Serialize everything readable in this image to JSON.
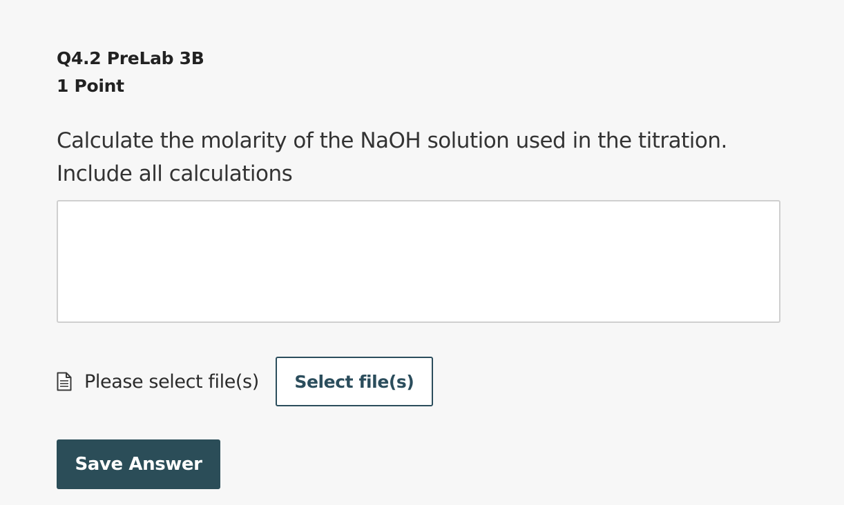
{
  "question": {
    "title": "Q4.2 PreLab 3B",
    "points": "1 Point",
    "prompt_line_1": "Calculate the molarity of the NaOH solution used in the titration.",
    "prompt_line_2": "Include all calculations"
  },
  "answer": {
    "value": "",
    "placeholder": ""
  },
  "file_upload": {
    "icon": "document-icon",
    "status_text": "Please select file(s)",
    "button_label": "Select file(s)"
  },
  "actions": {
    "save_label": "Save Answer"
  },
  "colors": {
    "background": "#f7f7f7",
    "accent": "#2b4d58",
    "text": "#2b2b2b"
  }
}
